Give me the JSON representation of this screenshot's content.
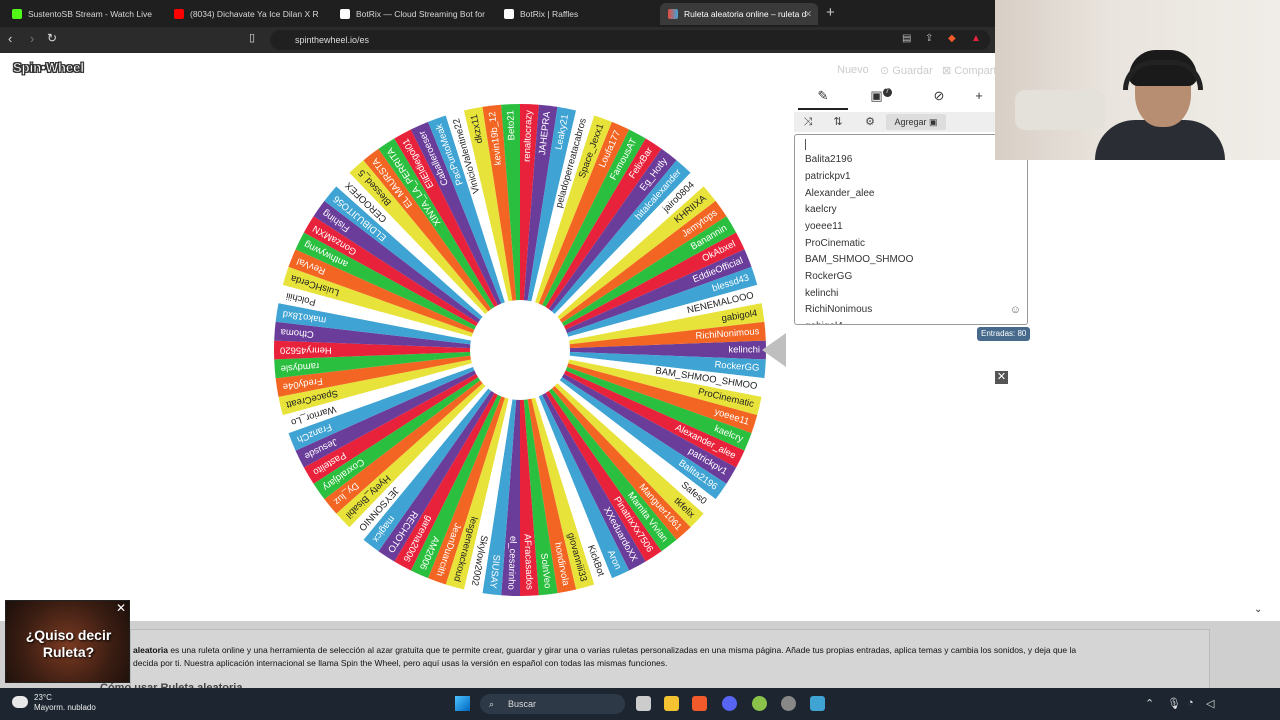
{
  "browser": {
    "tabs": [
      {
        "label": "SustentoSB Stream - Watch Live",
        "color": "#53fc18"
      },
      {
        "label": "(8034) Dichavate Ya Ice Dilan X R",
        "color": "#ff0000"
      },
      {
        "label": "BotRix — Cloud Streaming Bot for Tw",
        "color": "#ffffff"
      },
      {
        "label": "BotRix | Raffles",
        "color": "#ffffff"
      },
      {
        "label": "Ruleta aleatoria online – ruleta d",
        "color": "#e84a3c"
      }
    ],
    "url": "spinthewheel.io/es"
  },
  "app": {
    "logo": "Spin•Wheel",
    "menu": {
      "new": "Nuevo",
      "save": "Guardar",
      "share": "Compartir"
    }
  },
  "panel": {
    "tab_badge": "7",
    "add_label": "Agregar",
    "entries": [
      "Balita2196",
      "patrickpv1",
      "Alexander_alee",
      "kaelcry",
      "yoeee11",
      "ProCinematic",
      "BAM_SHMOO_SHMOO",
      "RockerGG",
      "kelinchi",
      "RichiNonimous",
      "gabigol4"
    ],
    "count_label": "Entradas: 80"
  },
  "wheel": {
    "colors": [
      "#6a3d9a",
      "#3fa4d4",
      "#ffffff",
      "#e8e33a",
      "#f26522",
      "#2bbf3f",
      "#e8223b"
    ],
    "labels": [
      "kelinchi",
      "RockerGG",
      "BAM_SHMOO_SHMOO",
      "ProCinematic",
      "yoeee11",
      "kaelcry",
      "Alexander_alee",
      "patrickpv1",
      "Balita2196",
      "Safes0",
      "tkfelix",
      "Manguer1061",
      "Mamita Vivian",
      "PinatrixXx7506",
      "XXeduardoXX",
      "Aron",
      "KickBot",
      "giovanniii33",
      "hondirvola",
      "SolnVeo",
      "AFracasados",
      "el_cesarinho",
      "SIUSAY",
      "Skylow2002",
      "lesgenerackoud",
      "JeanDuarcith",
      "AM2006",
      "garena2006",
      "RECHOTO",
      "magicx",
      "JEYSONNIO",
      "Hyety_Bisabil",
      "Dy_luz",
      "Coxraidjary",
      "Pastelito",
      "Jesusde",
      "FranzCh",
      "Warrior_Lo",
      "SpaceCreatt",
      "Fredy04e",
      "ramdysle",
      "Henry45620",
      "Cthoma",
      "mako18xd",
      "Polchiii",
      "LuisHCerda",
      "RevVal",
      "anthwywng",
      "GonzaMXN",
      "Fishing",
      "ELDIBUJITO56",
      "CEROOFEX",
      "Blessed_5",
      "EL MAURSTA",
      "XINYA_LA_PERRITA",
      "EliEldiegoi01",
      "Caballeroeser",
      "PacPuntoMeak",
      "VinicioValentine22",
      "dkzx11",
      "kevin19b_12",
      "Beto21",
      "renaltocrazy",
      "JAHEPRA",
      "Leaky21",
      "peladoperreatacabros",
      "Space_Jexx1",
      "Loufa177",
      "FamousAT",
      "FelixBar",
      "Eg_Hotly",
      "hitalcalexander",
      "jairo0804",
      "KHRIIXA",
      "Jemytops",
      "Banannin",
      "OkAbxel",
      "EddieOfficial",
      "blessd43",
      "NENEMALOOO",
      "gabigol4",
      "RichiNonimous"
    ]
  },
  "footer": {
    "bold": "aleatoria",
    "text": " es una ruleta online y una herramienta de selección al azar gratuita que te permite crear, guardar y girar una o varias ruletas personalizadas en una misma página. Añade tus propias entradas, aplica temas y cambia los sonidos, y deja que la",
    "text2": "decida por ti. Nuestra aplicación internacional se llama Spin the Wheel, pero aquí usas la versión en español con todas las mismas funciones.",
    "heading": "Cómo usar Ruleta aleatoria"
  },
  "popup": {
    "text": "¿Quiso decir Ruleta?"
  },
  "taskbar": {
    "temp": "23°C",
    "weather": "Mayorm. nublado",
    "search": "Buscar"
  }
}
